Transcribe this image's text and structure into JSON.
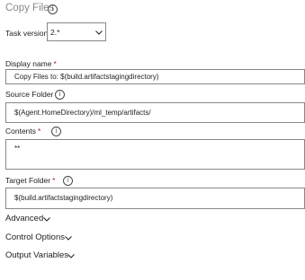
{
  "header": {
    "title": "Copy Files"
  },
  "task_version": {
    "label": "Task version",
    "value": "2.*"
  },
  "display_name": {
    "label": "Display name",
    "required_mark": "*",
    "value": "Copy Files to: $(build.artifactstagingdirectory)"
  },
  "source_folder": {
    "label": "Source Folder",
    "value": "$(Agent.HomeDirectory)/ml_temp/artifacts/"
  },
  "contents": {
    "label": "Contents",
    "required_mark": "*",
    "value": "**"
  },
  "target_folder": {
    "label": "Target Folder",
    "required_mark": "*",
    "value": "$(build.artifactstagingdirectory)"
  },
  "sections": {
    "advanced": "Advanced",
    "control_options": "Control Options",
    "output_variables": "Output Variables"
  },
  "icons": {
    "info": "info-icon",
    "chevron": "chevron-down-icon"
  },
  "colors": {
    "required": "#a4262c",
    "border": "#8a8886",
    "title": "#8a8886"
  }
}
